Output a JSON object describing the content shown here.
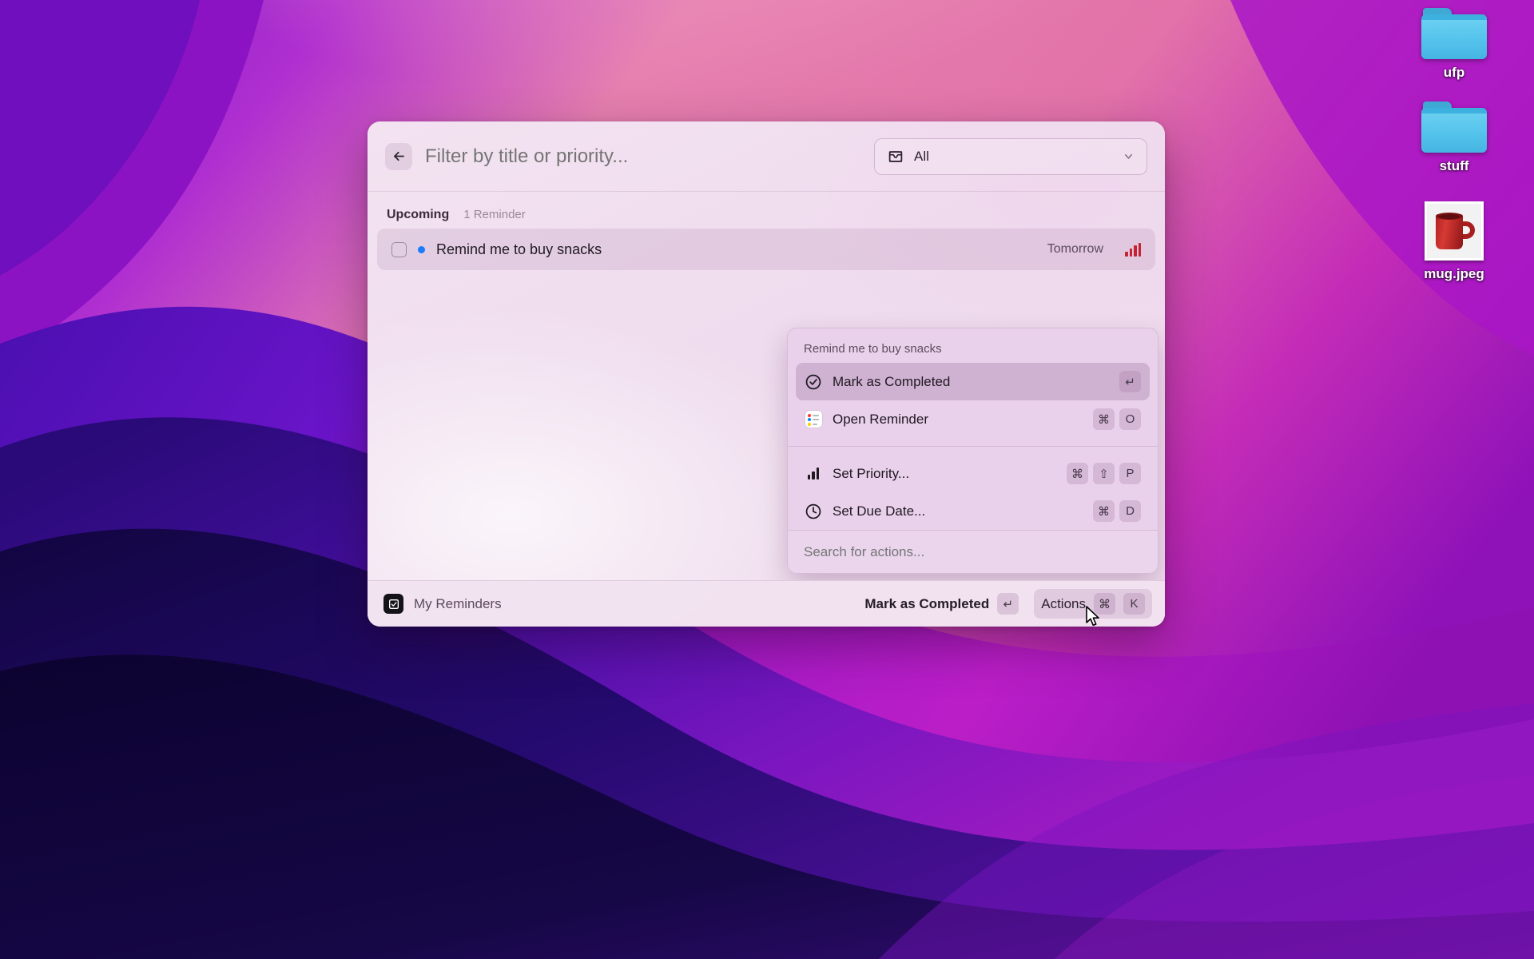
{
  "desktop": {
    "icons": [
      {
        "name": "ufp",
        "type": "folder"
      },
      {
        "name": "stuff",
        "type": "folder"
      },
      {
        "name": "mug.jpeg",
        "type": "image"
      }
    ]
  },
  "launcher": {
    "header": {
      "back_icon": "arrow-left-icon",
      "filter_placeholder": "Filter by title or priority...",
      "filter_value": "",
      "scope": {
        "icon": "inbox-icon",
        "selected": "All",
        "chevron": "chevron-down-icon"
      }
    },
    "list": {
      "section_title": "Upcoming",
      "section_count": "1 Reminder",
      "items": [
        {
          "title": "Remind me to buy snacks",
          "due": "Tomorrow",
          "completed": false,
          "flag_color": "#1a7dfb",
          "priority_icon": "priority-bars-icon",
          "priority_color": "#c62233"
        }
      ]
    },
    "action_panel": {
      "title": "Remind me to buy snacks",
      "groups": [
        {
          "items": [
            {
              "label": "Mark as Completed",
              "icon": "check-circle-icon",
              "keys": [
                "↵"
              ],
              "selected": true
            },
            {
              "label": "Open Reminder",
              "icon": "reminders-app-icon",
              "keys": [
                "⌘",
                "O"
              ],
              "selected": false
            }
          ]
        },
        {
          "items": [
            {
              "label": "Set Priority...",
              "icon": "priority-bars-icon",
              "keys": [
                "⌘",
                "⇧",
                "P"
              ],
              "selected": false
            },
            {
              "label": "Set Due Date...",
              "icon": "clock-icon",
              "keys": [
                "⌘",
                "D"
              ],
              "selected": false
            }
          ]
        }
      ],
      "search_placeholder": "Search for actions...",
      "search_value": ""
    },
    "footer": {
      "app_icon": "checkbox-app-icon",
      "app_label": "My Reminders",
      "primary_action": {
        "label": "Mark as Completed",
        "keys": [
          "↵"
        ]
      },
      "secondary_action": {
        "label": "Actions",
        "keys": [
          "⌘",
          "K"
        ]
      }
    }
  },
  "colors": {
    "accent_blue": "#1a7dfb",
    "priority_red": "#c62233",
    "window_bg": "#f3e3f1",
    "panel_bg": "#e8d1ea",
    "wallpaper_pink": "#e080ac",
    "wallpaper_purple": "#9b13c4",
    "wallpaper_indigo": "#1a0a4a"
  }
}
